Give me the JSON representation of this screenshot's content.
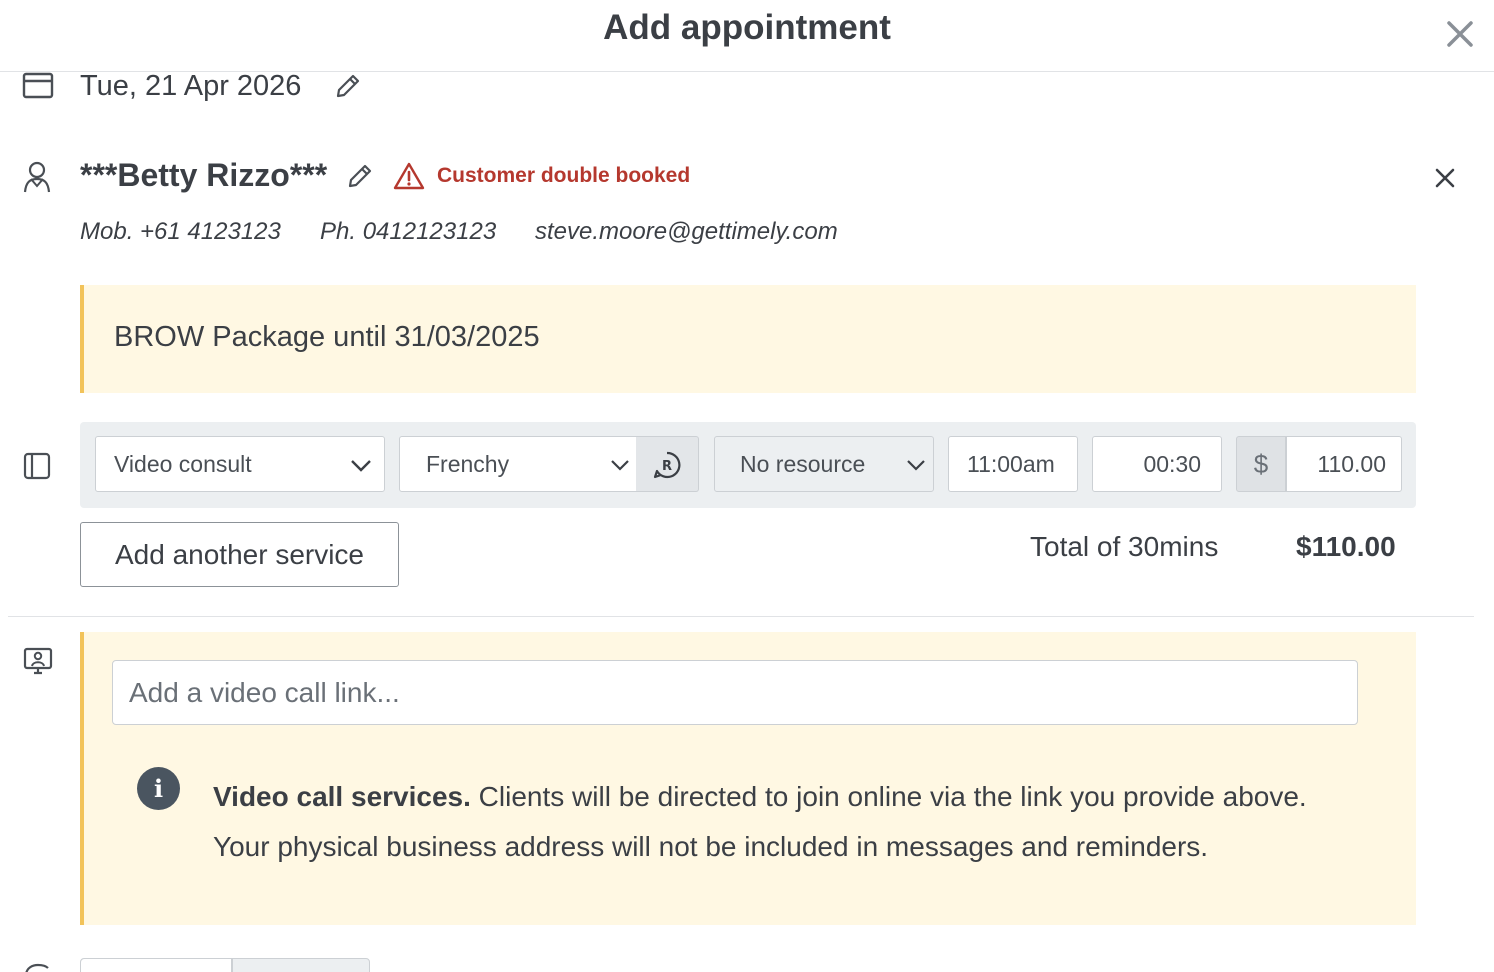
{
  "header": {
    "title": "Add appointment",
    "close_icon": "close-icon"
  },
  "date": {
    "icon": "calendar-icon",
    "value": "Tue, 21 Apr 2026",
    "edit_icon": "pencil-icon"
  },
  "customer": {
    "icon": "customer-icon",
    "name": "***Betty Rizzo***",
    "edit_icon": "pencil-icon",
    "warning_icon": "warning-triangle-icon",
    "warning": "Customer double booked",
    "remove_icon": "close-icon",
    "mobile": "Mob. +61 4123123",
    "phone": "Ph. 0412123123",
    "email": "steve.moore@gettimely.com"
  },
  "package_note": "BROW Package until 31/03/2025",
  "service": {
    "icon": "service-panel-icon",
    "name": "Video consult",
    "staff": "Frenchy",
    "staff_request_icon": "request-staff-icon",
    "resource": "No resource",
    "time": "11:00am",
    "duration": "00:30",
    "currency": "$",
    "price": "110.00"
  },
  "actions": {
    "add_service_label": "Add another service"
  },
  "totals": {
    "label": "Total of 30mins",
    "amount": "$110.00"
  },
  "video": {
    "icon": "video-call-icon",
    "placeholder": "Add a video call link...",
    "info_icon_glyph": "i",
    "info_title": "Video call services.",
    "info_body": " Clients will be directed to join online via the link you provide above. Your physical business address will not be included in messages and reminders."
  },
  "colors": {
    "warning": "#b5382e",
    "note_background": "#fff8e3",
    "note_border": "#f2c35a",
    "text": "#3b3f45"
  }
}
